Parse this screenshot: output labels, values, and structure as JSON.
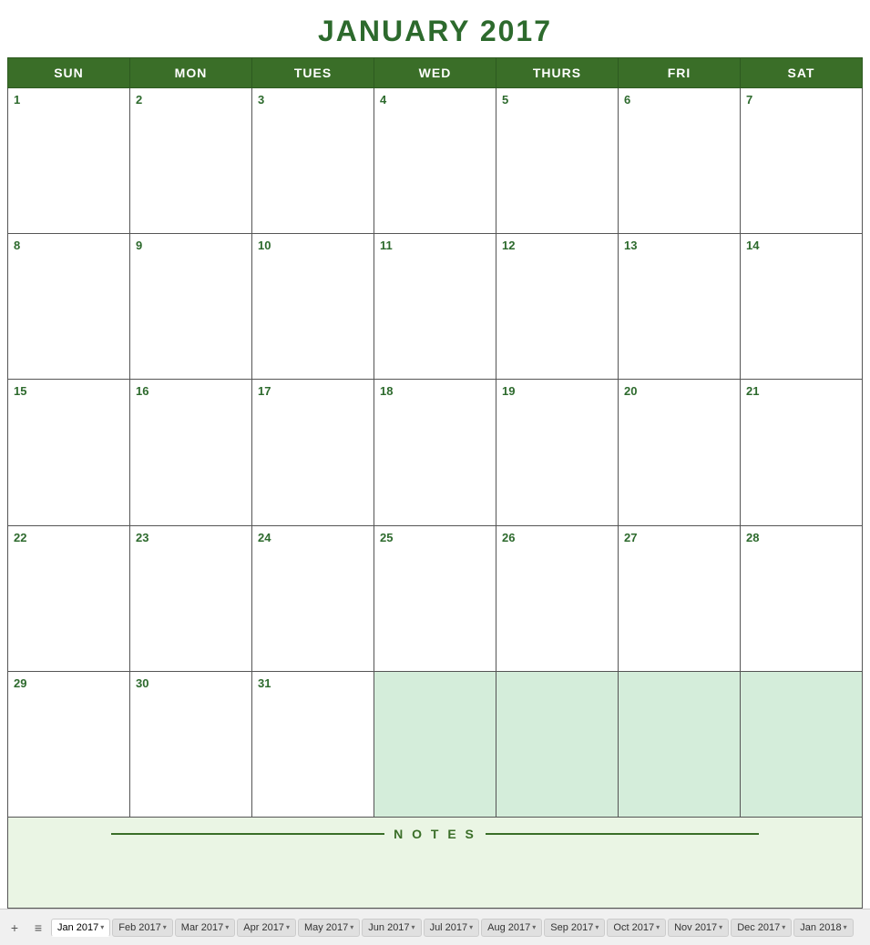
{
  "title": "JANUARY 2017",
  "header": {
    "days": [
      "SUN",
      "MON",
      "TUES",
      "WED",
      "THURS",
      "FRI",
      "SAT"
    ]
  },
  "weeks": [
    [
      {
        "day": "1",
        "current": true
      },
      {
        "day": "2",
        "current": true
      },
      {
        "day": "3",
        "current": true
      },
      {
        "day": "4",
        "current": true
      },
      {
        "day": "5",
        "current": true
      },
      {
        "day": "6",
        "current": true
      },
      {
        "day": "7",
        "current": true
      }
    ],
    [
      {
        "day": "8",
        "current": true
      },
      {
        "day": "9",
        "current": true
      },
      {
        "day": "10",
        "current": true
      },
      {
        "day": "11",
        "current": true
      },
      {
        "day": "12",
        "current": true
      },
      {
        "day": "13",
        "current": true
      },
      {
        "day": "14",
        "current": true
      }
    ],
    [
      {
        "day": "15",
        "current": true
      },
      {
        "day": "16",
        "current": true
      },
      {
        "day": "17",
        "current": true
      },
      {
        "day": "18",
        "current": true
      },
      {
        "day": "19",
        "current": true
      },
      {
        "day": "20",
        "current": true
      },
      {
        "day": "21",
        "current": true
      }
    ],
    [
      {
        "day": "22",
        "current": true
      },
      {
        "day": "23",
        "current": true
      },
      {
        "day": "24",
        "current": true
      },
      {
        "day": "25",
        "current": true
      },
      {
        "day": "26",
        "current": true
      },
      {
        "day": "27",
        "current": true
      },
      {
        "day": "28",
        "current": true
      }
    ],
    [
      {
        "day": "29",
        "current": true
      },
      {
        "day": "30",
        "current": true
      },
      {
        "day": "31",
        "current": true
      },
      {
        "day": "",
        "current": false
      },
      {
        "day": "",
        "current": false
      },
      {
        "day": "",
        "current": false
      },
      {
        "day": "",
        "current": false
      }
    ]
  ],
  "notes": {
    "label": "N O T E S"
  },
  "bottomTabs": {
    "addIcon": "+",
    "menuIcon": "≡",
    "tabs": [
      {
        "label": "Jan 2017",
        "active": true
      },
      {
        "label": "Feb 2017",
        "active": false
      },
      {
        "label": "Mar 2017",
        "active": false
      },
      {
        "label": "Apr 2017",
        "active": false
      },
      {
        "label": "May 2017",
        "active": false
      },
      {
        "label": "Jun 2017",
        "active": false
      },
      {
        "label": "Jul 2017",
        "active": false
      },
      {
        "label": "Aug 2017",
        "active": false
      },
      {
        "label": "Sep 2017",
        "active": false
      },
      {
        "label": "Oct 2017",
        "active": false
      },
      {
        "label": "Nov 2017",
        "active": false
      },
      {
        "label": "Dec 2017",
        "active": false
      },
      {
        "label": "Jan 2018",
        "active": false
      }
    ]
  }
}
